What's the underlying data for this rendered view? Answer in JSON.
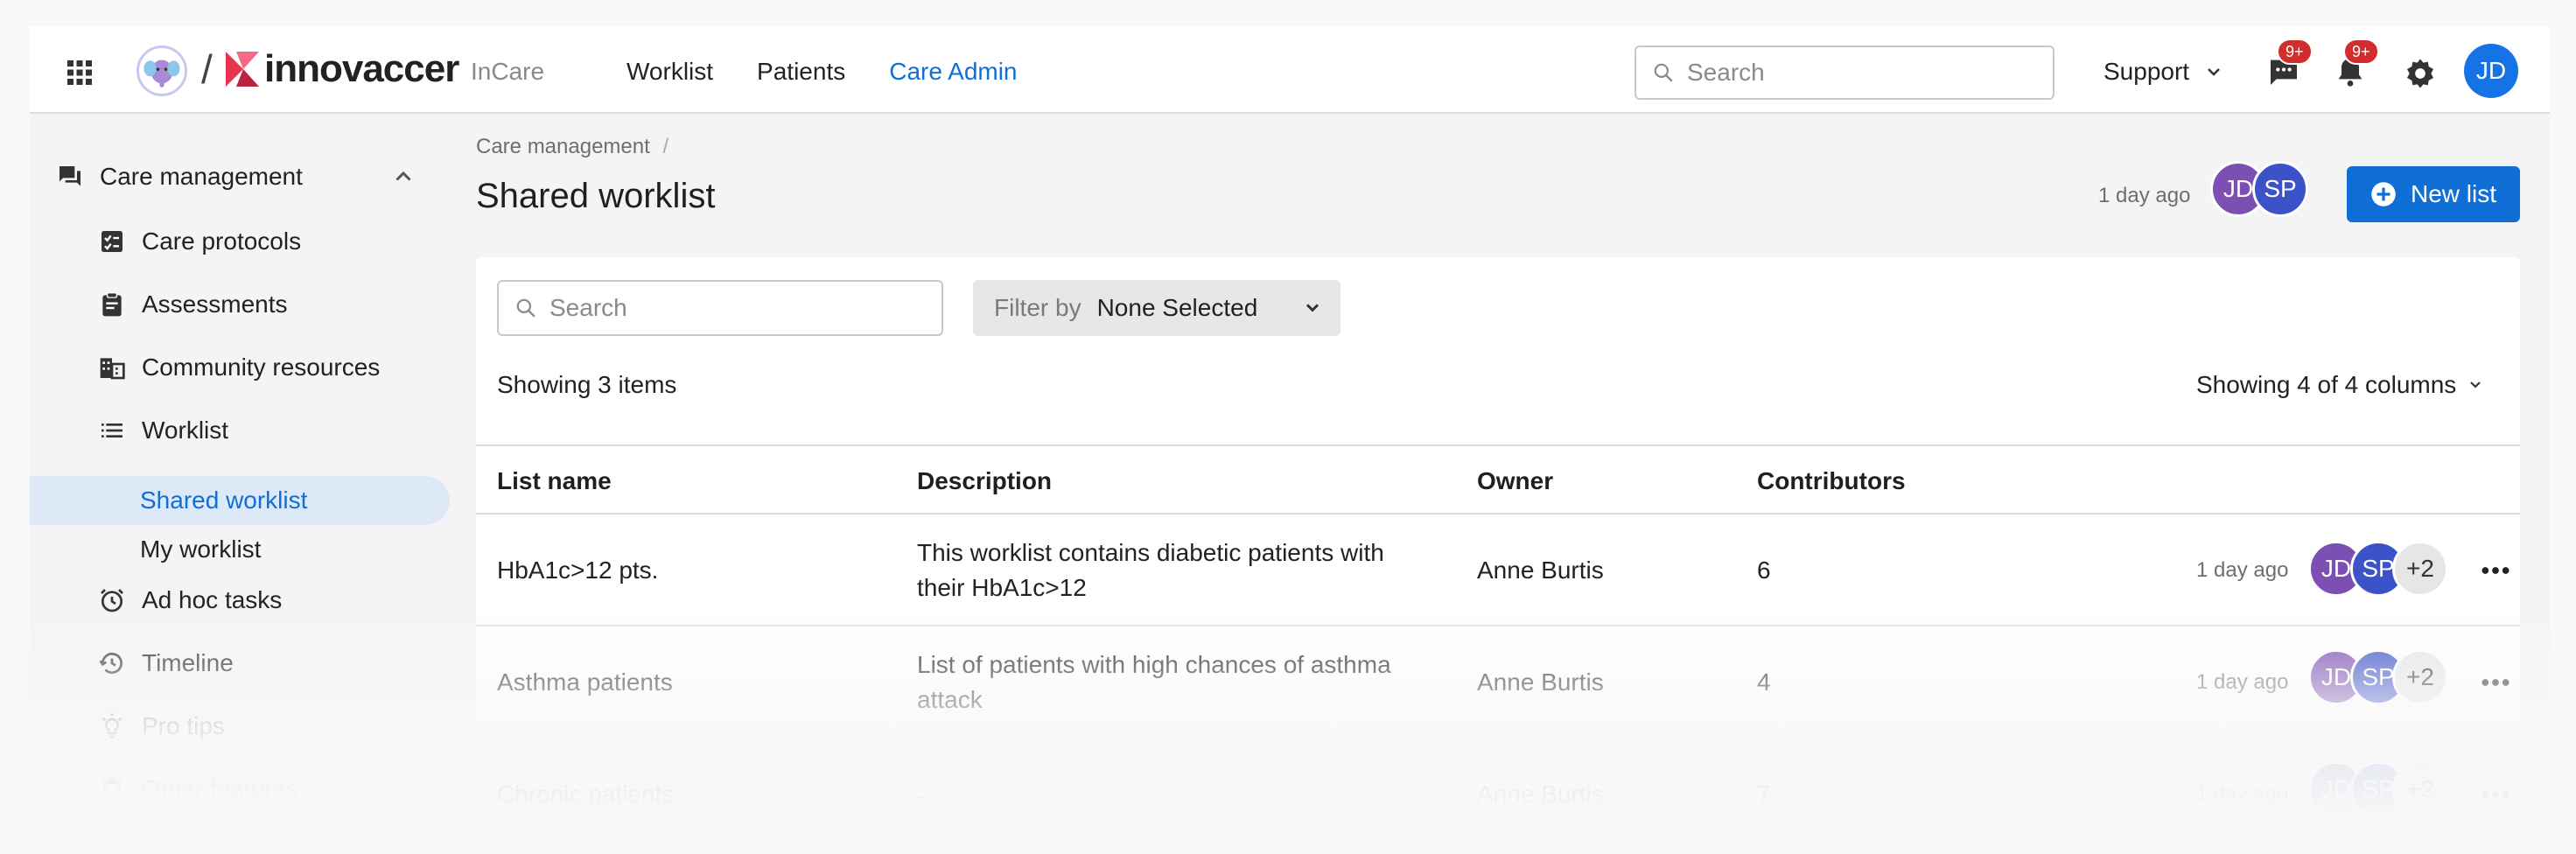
{
  "header": {
    "brand": "innovaccer",
    "product": "InCare",
    "nav": [
      "Worklist",
      "Patients",
      "Care Admin"
    ],
    "search_placeholder": "Search",
    "support_label": "Support",
    "chat_badge": "9+",
    "bell_badge": "9+",
    "user_initials": "JD"
  },
  "sidebar": {
    "section": "Care management",
    "items": [
      "Care protocols",
      "Assessments",
      "Community resources",
      "Worklist"
    ],
    "worklist_sub": [
      "Shared worklist",
      "My worklist"
    ],
    "more_items": [
      "Ad hoc tasks",
      "Timeline",
      "Pro tips",
      "Other features"
    ]
  },
  "page": {
    "breadcrumb": "Care management",
    "breadcrumb_sep": "/",
    "title": "Shared worklist",
    "updated": "1 day ago",
    "avatars": [
      "JD",
      "SP"
    ],
    "new_button": "New list"
  },
  "table": {
    "search_placeholder": "Search",
    "filter_label": "Filter by",
    "filter_value": "None Selected",
    "showing_items": "Showing 3 items",
    "showing_columns": "Showing 4 of 4 columns",
    "columns": [
      "List name",
      "Description",
      "Owner",
      "Contributors"
    ],
    "rows": [
      {
        "name": "HbA1c>12 pts.",
        "desc_line1": "This worklist contains diabetic patients with",
        "desc_line2": "their HbA1c>12",
        "owner": "Anne Burtis",
        "contributors": "6",
        "updated": "1 day ago",
        "avatars": [
          "JD",
          "SP",
          "+2"
        ]
      },
      {
        "name": "Asthma patients",
        "desc_line1": "List of patients with high chances of asthma",
        "desc_line2": "attack",
        "owner": "Anne Burtis",
        "contributors": "4",
        "updated": "1 day ago",
        "avatars": [
          "JD",
          "SP",
          "+2"
        ]
      },
      {
        "name": "Chronic patients",
        "desc_line1": "-",
        "desc_line2": "",
        "owner": "Anne Burtis",
        "contributors": "7",
        "updated": "1 day ago",
        "avatars": [
          "JD",
          "SP",
          "+2"
        ]
      }
    ]
  },
  "colors": {
    "primary": "#0f6fd6",
    "avatar_jd": "#7c4fb3",
    "avatar_sp": "#3c52c9",
    "badge": "#d12d2d",
    "active_bg": "#dde9f6"
  }
}
